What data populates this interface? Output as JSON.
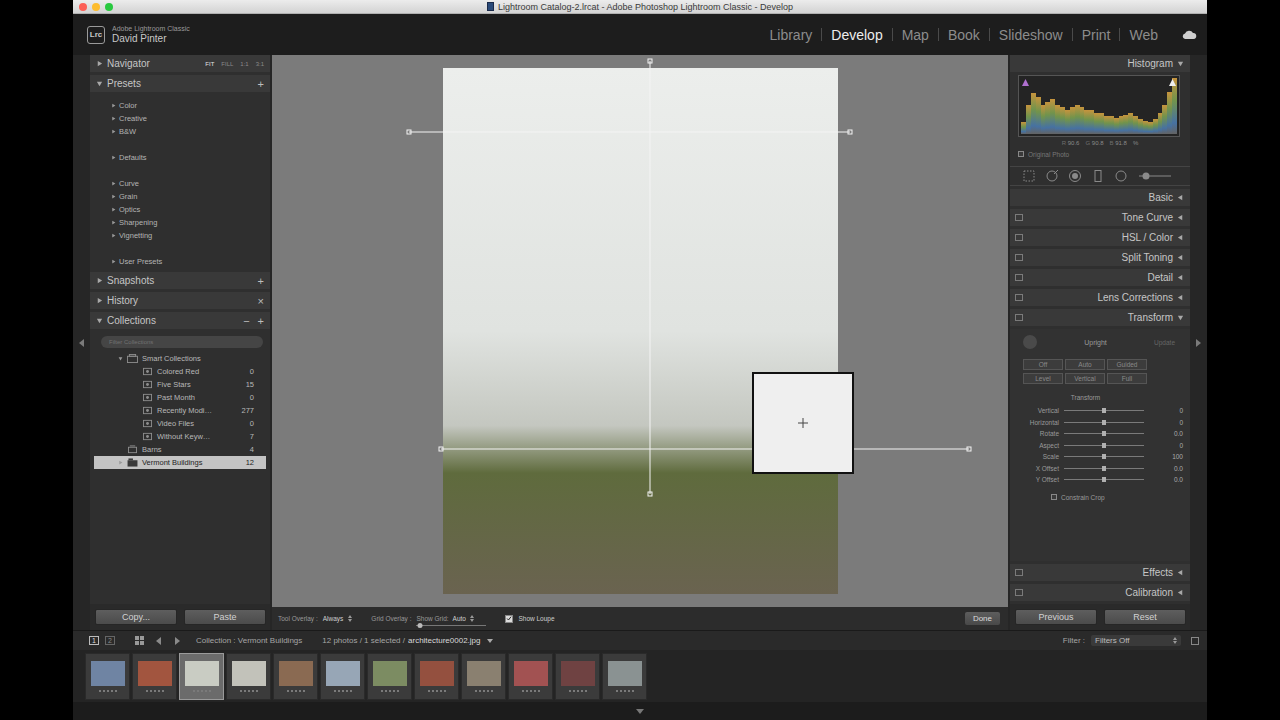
{
  "window": {
    "title": "Lightroom Catalog-2.lrcat - Adobe Photoshop Lightroom Classic - Develop"
  },
  "identity": {
    "logo": "Lrc",
    "app": "Adobe Lightroom Classic",
    "user": "David Pinter"
  },
  "modules": [
    {
      "label": "Library",
      "selected": false
    },
    {
      "label": "Develop",
      "selected": true
    },
    {
      "label": "Map",
      "selected": false
    },
    {
      "label": "Book",
      "selected": false
    },
    {
      "label": "Slideshow",
      "selected": false
    },
    {
      "label": "Print",
      "selected": false
    },
    {
      "label": "Web",
      "selected": false
    }
  ],
  "left_panel": {
    "navigator": {
      "title": "Navigator",
      "expanded": false,
      "zoom": [
        {
          "label": "FIT",
          "selected": true
        },
        {
          "label": "FILL",
          "selected": false
        },
        {
          "label": "1:1",
          "selected": false
        },
        {
          "label": "3:1",
          "selected": false
        }
      ]
    },
    "presets": {
      "title": "Presets",
      "expanded": true,
      "action": "+",
      "groups": [
        [
          {
            "label": "Color",
            "expanded": false
          },
          {
            "label": "Creative",
            "expanded": false
          },
          {
            "label": "B&W",
            "expanded": false
          }
        ],
        [
          {
            "label": "Defaults",
            "expanded": false
          }
        ],
        [
          {
            "label": "Curve",
            "expanded": false
          },
          {
            "label": "Grain",
            "expanded": false
          },
          {
            "label": "Optics",
            "expanded": false
          },
          {
            "label": "Sharpening",
            "expanded": false
          },
          {
            "label": "Vignetting",
            "expanded": false
          }
        ],
        [
          {
            "label": "User Presets",
            "expanded": false
          }
        ]
      ]
    },
    "snapshots": {
      "title": "Snapshots",
      "expanded": false,
      "action": "+"
    },
    "history": {
      "title": "History",
      "expanded": false,
      "action": "×"
    },
    "collections": {
      "title": "Collections",
      "expanded": true,
      "actions": [
        "−",
        "+"
      ],
      "filter_placeholder": "Filter Collections",
      "items": [
        {
          "name": "Smart Collections",
          "count": "",
          "kind": "smart-set",
          "depth": 0,
          "has_children": true,
          "expanded": true,
          "selected": false
        },
        {
          "name": "Colored Red",
          "count": "0",
          "kind": "smart",
          "depth": 1,
          "has_children": false,
          "expanded": false,
          "selected": false
        },
        {
          "name": "Five Stars",
          "count": "15",
          "kind": "smart",
          "depth": 1,
          "has_children": false,
          "expanded": false,
          "selected": false
        },
        {
          "name": "Past Month",
          "count": "0",
          "kind": "smart",
          "depth": 1,
          "has_children": false,
          "expanded": false,
          "selected": false
        },
        {
          "name": "Recently Modi…",
          "count": "277",
          "kind": "smart",
          "depth": 1,
          "has_children": false,
          "expanded": false,
          "selected": false
        },
        {
          "name": "Video Files",
          "count": "0",
          "kind": "smart",
          "depth": 1,
          "has_children": false,
          "expanded": false,
          "selected": false
        },
        {
          "name": "Without Keyw…",
          "count": "7",
          "kind": "smart",
          "depth": 1,
          "has_children": false,
          "expanded": false,
          "selected": false
        },
        {
          "name": "Barns",
          "count": "4",
          "kind": "collection",
          "depth": 0,
          "has_children": false,
          "expanded": false,
          "selected": false
        },
        {
          "name": "Vermont Buildings",
          "count": "12",
          "kind": "set",
          "depth": 0,
          "has_children": true,
          "expanded": false,
          "selected": true
        }
      ]
    },
    "buttons": [
      "Copy...",
      "Paste"
    ]
  },
  "toolbar": {
    "tool_overlay": {
      "label": "Tool Overlay :",
      "value": "Always"
    },
    "grid_overlay": {
      "label": "Grid Overlay :",
      "show_grid": "Show Grid:",
      "value": "Auto",
      "level": 0.05
    },
    "show_loupe": {
      "label": "Show Loupe",
      "checked": true
    },
    "done": "Done"
  },
  "right_panel": {
    "histogram": {
      "title": "Histogram",
      "expanded": true,
      "values": [
        0.2,
        0.5,
        0.7,
        0.62,
        0.5,
        0.55,
        0.6,
        0.5,
        0.45,
        0.4,
        0.45,
        0.5,
        0.45,
        0.4,
        0.4,
        0.36,
        0.35,
        0.3,
        0.3,
        0.28,
        0.3,
        0.32,
        0.35,
        0.3,
        0.26,
        0.22,
        0.2,
        0.25,
        0.35,
        0.5,
        0.72,
        0.95
      ],
      "readout": [
        {
          "label": "R",
          "value": "90.6"
        },
        {
          "label": "G",
          "value": "90.8"
        },
        {
          "label": "B",
          "value": "91.8"
        }
      ],
      "unit": "%"
    },
    "original_photo": {
      "label": "Original Photo",
      "checked": false
    },
    "tools": [
      {
        "kind": "crop",
        "selected": false
      },
      {
        "kind": "spot",
        "selected": false
      },
      {
        "kind": "red-eye",
        "selected": false
      },
      {
        "kind": "graduated",
        "selected": false
      },
      {
        "kind": "radial",
        "selected": false
      },
      {
        "kind": "brush",
        "selected": false
      }
    ],
    "panels": [
      {
        "title": "Basic",
        "expanded": false,
        "has_toggle": false
      },
      {
        "title": "Tone Curve",
        "expanded": false,
        "has_toggle": true
      },
      {
        "title": "HSL / Color",
        "expanded": false,
        "has_toggle": true
      },
      {
        "title": "Split Toning",
        "expanded": false,
        "has_toggle": true
      },
      {
        "title": "Detail",
        "expanded": false,
        "has_toggle": true
      },
      {
        "title": "Lens Corrections",
        "expanded": false,
        "has_toggle": true
      },
      {
        "title": "Transform",
        "expanded": true,
        "has_toggle": true
      },
      {
        "title": "Effects",
        "expanded": false,
        "has_toggle": true
      },
      {
        "title": "Calibration",
        "expanded": false,
        "has_toggle": true
      }
    ],
    "transform": {
      "upright_label": "Upright",
      "update": "Update",
      "update_disabled": true,
      "upright_buttons": [
        {
          "label": "Off",
          "selected": false
        },
        {
          "label": "Auto",
          "selected": false
        },
        {
          "label": "Guided",
          "selected": false
        },
        {
          "label": "Level",
          "selected": false
        },
        {
          "label": "Vertical",
          "selected": false
        },
        {
          "label": "Full",
          "selected": false
        }
      ],
      "sliders_title": "Transform",
      "sliders": [
        {
          "label": "Vertical",
          "value": "0",
          "level": 0.5
        },
        {
          "label": "Horizontal",
          "value": "0",
          "level": 0.5
        },
        {
          "label": "Rotate",
          "value": "0.0",
          "level": 0.5
        },
        {
          "label": "Aspect",
          "value": "0",
          "level": 0.5
        },
        {
          "label": "Scale",
          "value": "100",
          "level": 0.5
        },
        {
          "label": "X Offset",
          "value": "0.0",
          "level": 0.5
        },
        {
          "label": "Y Offset",
          "value": "0.0",
          "level": 0.5
        }
      ],
      "constrain_crop": {
        "label": "Constrain Crop",
        "checked": false
      }
    },
    "buttons": [
      "Previous",
      "Reset"
    ]
  },
  "filmstrip": {
    "screens": [
      {
        "label": "1",
        "selected": true
      },
      {
        "label": "2",
        "selected": false
      }
    ],
    "source": "Collection : Vermont Buildings",
    "count": "12 photos / 1 selected /",
    "file": "architecture0002.jpg",
    "filter_label": "Filter :",
    "filter_value": "Filters Off",
    "thumbnails": [
      {
        "color": "#6f84a3",
        "selected": false,
        "stars": 0
      },
      {
        "color": "#a2553f",
        "selected": false,
        "stars": 0
      },
      {
        "color": "#c9ccc3",
        "selected": true,
        "stars": 0
      },
      {
        "color": "#c2c2ba",
        "selected": false,
        "stars": 0
      },
      {
        "color": "#8a6a52",
        "selected": false,
        "stars": 0
      },
      {
        "color": "#97a6b6",
        "selected": false,
        "stars": 0
      },
      {
        "color": "#7c8c62",
        "selected": false,
        "stars": 0
      },
      {
        "color": "#94503f",
        "selected": false,
        "stars": 0
      },
      {
        "color": "#8a8070",
        "selected": false,
        "stars": 0
      },
      {
        "color": "#a25252",
        "selected": false,
        "stars": 0
      },
      {
        "color": "#6f4242",
        "selected": false,
        "stars": 0
      },
      {
        "color": "#8a9292",
        "selected": false,
        "stars": 0
      }
    ]
  }
}
